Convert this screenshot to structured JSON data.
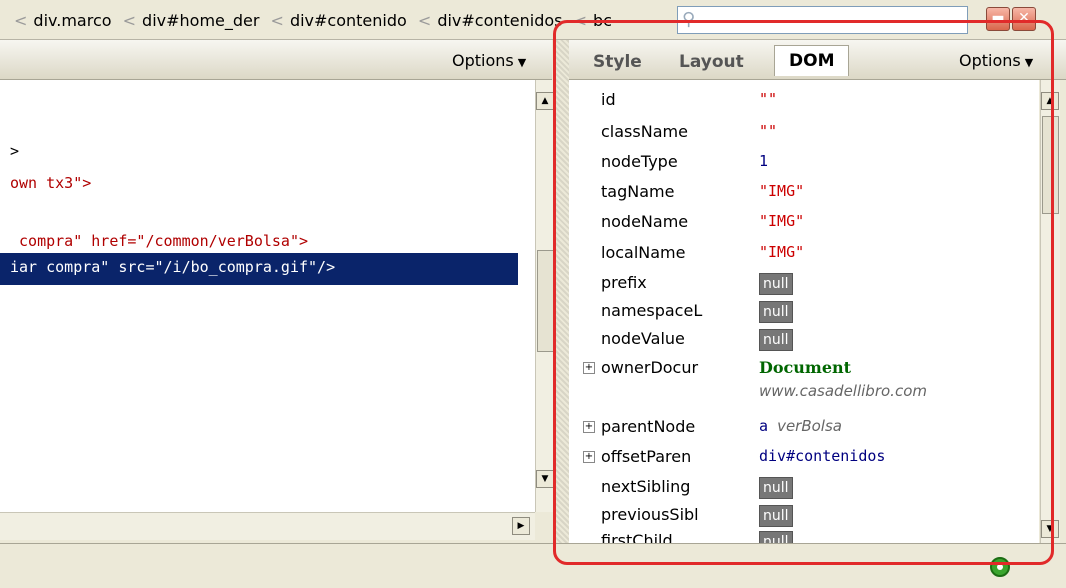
{
  "breadcrumb": [
    "div.marco",
    "div#home_der",
    "div#contenido",
    "div#contenidos",
    "bc"
  ],
  "search": {
    "placeholder": ""
  },
  "left_panel": {
    "options_label": "Options",
    "code_lines": [
      {
        "text": ">",
        "style": "dark"
      },
      {
        "text": "own tx3\">",
        "style": "red"
      },
      {
        "text": "",
        "style": "dark"
      },
      {
        "text": " compra\" href=\"/common/verBolsa\">",
        "style": "red"
      }
    ],
    "selected_line": "iar compra\" src=\"/i/bo_compra.gif\"/>"
  },
  "right_panel": {
    "tabs": [
      "Style",
      "Layout",
      "DOM"
    ],
    "active_tab": "DOM",
    "options_label": "Options",
    "properties": [
      {
        "name": "id",
        "value": "\"\"",
        "type": "str"
      },
      {
        "name": "className",
        "value": "\"\"",
        "type": "str"
      },
      {
        "name": "nodeType",
        "value": "1",
        "type": "num"
      },
      {
        "name": "tagName",
        "value": "\"IMG\"",
        "type": "str"
      },
      {
        "name": "nodeName",
        "value": "\"IMG\"",
        "type": "str"
      },
      {
        "name": "localName",
        "value": "\"IMG\"",
        "type": "str"
      },
      {
        "name": "prefix",
        "value": "null",
        "type": "null"
      },
      {
        "name": "namespaceL",
        "value": "null",
        "type": "null"
      },
      {
        "name": "nodeValue",
        "value": "null",
        "type": "null"
      },
      {
        "name": "ownerDocur",
        "value": "Document",
        "type": "obj",
        "expandable": true,
        "subtext": "www.casadellibro.com"
      },
      {
        "name": "parentNode",
        "value": "a",
        "type": "el",
        "expandable": true,
        "suffix": "verBolsa"
      },
      {
        "name": "offsetParen",
        "value": "div#contenidos",
        "type": "el",
        "expandable": true
      },
      {
        "name": "nextSibling",
        "value": "null",
        "type": "null"
      },
      {
        "name": "previousSibl",
        "value": "null",
        "type": "null"
      },
      {
        "name": "firstChild",
        "value": "null",
        "type": "null"
      }
    ]
  },
  "colors": {
    "highlight": "#e12a2a",
    "selection": "#0a246a"
  }
}
